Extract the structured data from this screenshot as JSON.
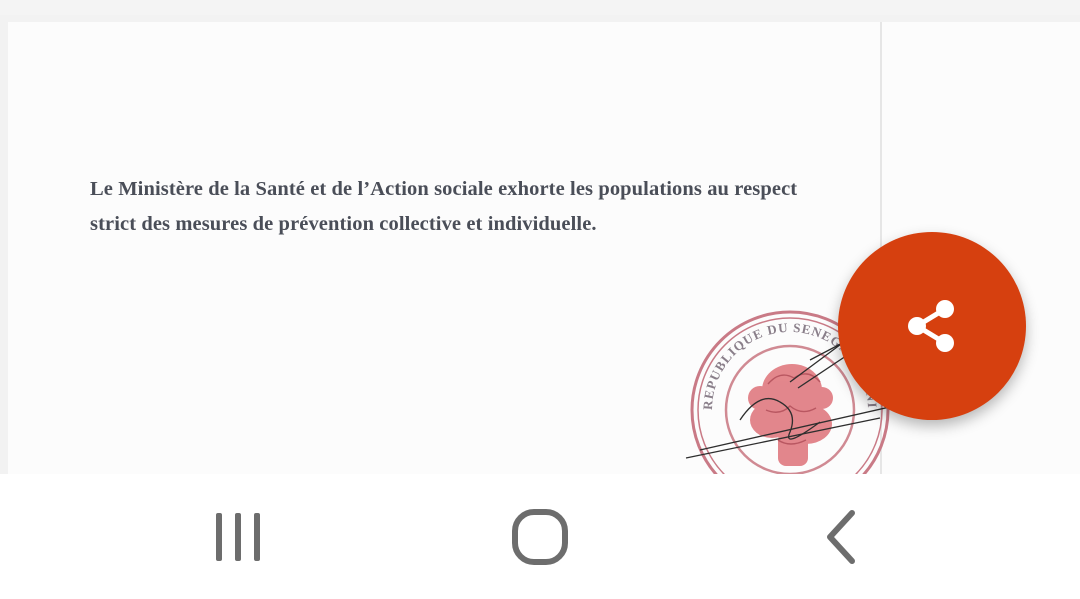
{
  "document": {
    "line1": "Le Ministère de la Santé et de l’Action sociale exhorte les populations au respect",
    "line2": "strict des mesures de prévention collective et individuelle.",
    "stamp_text": "République du Sénégal · Ministère de la Santé et de l’Action sociale"
  },
  "fab": {
    "icon": "share-icon",
    "color": "#d6400f"
  },
  "navigation_bar": {
    "recents_icon": "recents-icon",
    "home_icon": "home-icon",
    "back_icon": "back-icon"
  }
}
